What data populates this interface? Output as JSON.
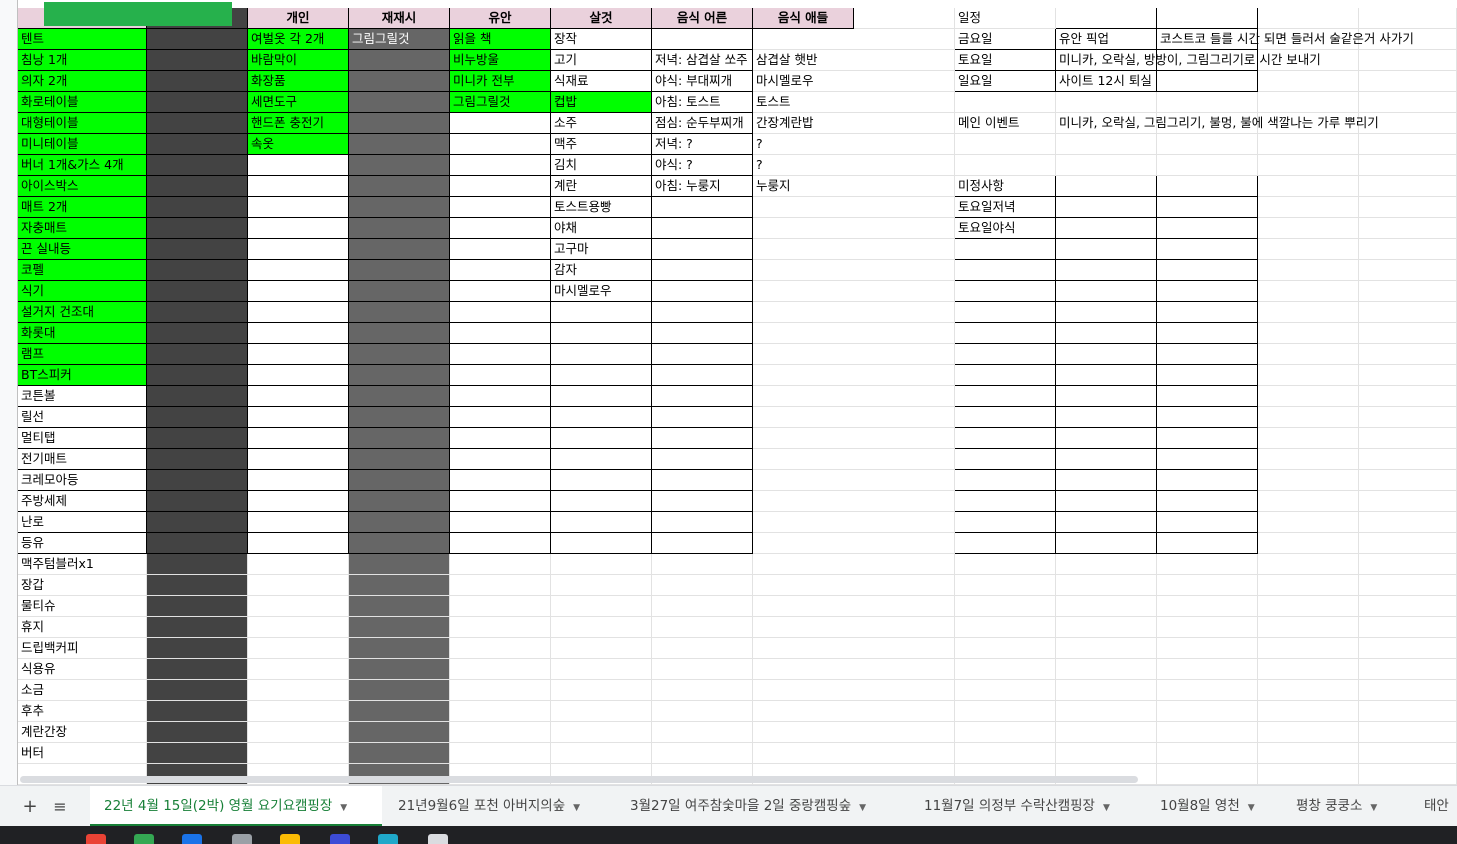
{
  "sheet": {
    "rows": [
      {
        "a": "",
        "b": "",
        "c": "개인",
        "d": "재재시",
        "e": "유안",
        "f": "살것",
        "g": "음식 어른",
        "h": "음식 애들",
        "j": "일정",
        "k": "",
        "l": ""
      },
      {
        "a": "텐트",
        "b": "",
        "c": "여벌옷 각 2개",
        "d": "그림그릴것",
        "e": "읽을 책",
        "f": "장작",
        "g": "",
        "h": "",
        "j": "금요일",
        "k": "유안 픽업",
        "l": "코스트코 들를 시간 되면 들러서 술같은거 사가기"
      },
      {
        "a": "침낭 1개",
        "b": "",
        "c": "바람막이",
        "d": "",
        "e": "비누방울",
        "f": "고기",
        "g": "저녁: 삼겹살 쏘주",
        "h": "삼겹살 햇반",
        "j": "토요일",
        "k": "미니카, 오락실, 방방이, 그림그리기로 시간 보내기",
        "l": ""
      },
      {
        "a": "의자 2개",
        "b": "",
        "c": "화장품",
        "d": "",
        "e": "미니카 전부",
        "f": "식재료",
        "g": "야식: 부대찌개",
        "h": "마시멜로우",
        "j": "일요일",
        "k": "사이트 12시 퇴실",
        "l": ""
      },
      {
        "a": "화로테이블",
        "b": "",
        "c": "세면도구",
        "d": "",
        "e": "그림그릴것",
        "f": "컵밥",
        "g": "아침: 토스트",
        "h": "토스트",
        "j": "",
        "k": "",
        "l": ""
      },
      {
        "a": "대형테이블",
        "b": "",
        "c": "핸드폰 충전기",
        "d": "",
        "e": "",
        "f": "소주",
        "g": "점심: 순두부찌개",
        "h": "간장계란밥",
        "j": "메인 이벤트",
        "k": "미니카, 오락실, 그림그리기, 불멍, 불에 색깔나는 가루 뿌리기",
        "l": ""
      },
      {
        "a": "미니테이블",
        "b": "",
        "c": "속옷",
        "d": "",
        "e": "",
        "f": "맥주",
        "g": "저녁: ?",
        "h": "?",
        "j": "",
        "k": "",
        "l": ""
      },
      {
        "a": "버너 1개&가스 4개",
        "b": "",
        "c": "",
        "d": "",
        "e": "",
        "f": "김치",
        "g": "야식: ?",
        "h": "?",
        "j": "",
        "k": "",
        "l": ""
      },
      {
        "a": "아이스박스",
        "b": "",
        "c": "",
        "d": "",
        "e": "",
        "f": "계란",
        "g": "아침: 누룽지",
        "h": "누룽지",
        "j": "미정사항",
        "k": "",
        "l": ""
      },
      {
        "a": "매트 2개",
        "b": "",
        "c": "",
        "d": "",
        "e": "",
        "f": "토스트용빵",
        "g": "",
        "h": "",
        "j": "토요일저녁",
        "k": "",
        "l": ""
      },
      {
        "a": "자충매트",
        "b": "",
        "c": "",
        "d": "",
        "e": "",
        "f": "야채",
        "g": "",
        "h": "",
        "j": "토요일야식",
        "k": "",
        "l": ""
      },
      {
        "a": "끈 실내등",
        "b": "",
        "c": "",
        "d": "",
        "e": "",
        "f": "고구마",
        "g": "",
        "h": "",
        "j": "",
        "k": "",
        "l": ""
      },
      {
        "a": "코펠",
        "b": "",
        "c": "",
        "d": "",
        "e": "",
        "f": "감자",
        "g": "",
        "h": "",
        "j": "",
        "k": "",
        "l": ""
      },
      {
        "a": "식기",
        "b": "",
        "c": "",
        "d": "",
        "e": "",
        "f": "마시멜로우",
        "g": "",
        "h": "",
        "j": "",
        "k": "",
        "l": ""
      },
      {
        "a": "설거지 건조대",
        "b": "",
        "c": "",
        "d": "",
        "e": "",
        "f": "",
        "g": "",
        "h": "",
        "j": "",
        "k": "",
        "l": ""
      },
      {
        "a": "화롯대",
        "b": "",
        "c": "",
        "d": "",
        "e": "",
        "f": "",
        "g": "",
        "h": "",
        "j": "",
        "k": "",
        "l": ""
      },
      {
        "a": "램프",
        "b": "",
        "c": "",
        "d": "",
        "e": "",
        "f": "",
        "g": "",
        "h": "",
        "j": "",
        "k": "",
        "l": ""
      },
      {
        "a": "BT스피커",
        "b": "",
        "c": "",
        "d": "",
        "e": "",
        "f": "",
        "g": "",
        "h": "",
        "j": "",
        "k": "",
        "l": ""
      },
      {
        "a": "코튼볼",
        "b": "",
        "c": "",
        "d": "",
        "e": "",
        "f": "",
        "g": "",
        "h": "",
        "j": "",
        "k": "",
        "l": ""
      },
      {
        "a": "릴선",
        "b": "",
        "c": "",
        "d": "",
        "e": "",
        "f": "",
        "g": "",
        "h": "",
        "j": "",
        "k": "",
        "l": ""
      },
      {
        "a": "멀티탭",
        "b": "",
        "c": "",
        "d": "",
        "e": "",
        "f": "",
        "g": "",
        "h": "",
        "j": "",
        "k": "",
        "l": ""
      },
      {
        "a": "전기매트",
        "b": "",
        "c": "",
        "d": "",
        "e": "",
        "f": "",
        "g": "",
        "h": "",
        "j": "",
        "k": "",
        "l": ""
      },
      {
        "a": "크레모아등",
        "b": "",
        "c": "",
        "d": "",
        "e": "",
        "f": "",
        "g": "",
        "h": "",
        "j": "",
        "k": "",
        "l": ""
      },
      {
        "a": "주방세제",
        "b": "",
        "c": "",
        "d": "",
        "e": "",
        "f": "",
        "g": "",
        "h": "",
        "j": "",
        "k": "",
        "l": ""
      },
      {
        "a": "난로",
        "b": "",
        "c": "",
        "d": "",
        "e": "",
        "f": "",
        "g": "",
        "h": "",
        "j": "",
        "k": "",
        "l": ""
      },
      {
        "a": "등유",
        "b": "",
        "c": "",
        "d": "",
        "e": "",
        "f": "",
        "g": "",
        "h": "",
        "j": "",
        "k": "",
        "l": ""
      },
      {
        "a": "맥주텀블러x1",
        "b": "",
        "c": "",
        "d": "",
        "e": "",
        "f": "",
        "g": "",
        "h": "",
        "j": "",
        "k": "",
        "l": ""
      },
      {
        "a": "장갑",
        "b": "",
        "c": "",
        "d": "",
        "e": "",
        "f": "",
        "g": "",
        "h": "",
        "j": "",
        "k": "",
        "l": ""
      },
      {
        "a": "물티슈",
        "b": "",
        "c": "",
        "d": "",
        "e": "",
        "f": "",
        "g": "",
        "h": "",
        "j": "",
        "k": "",
        "l": ""
      },
      {
        "a": "휴지",
        "b": "",
        "c": "",
        "d": "",
        "e": "",
        "f": "",
        "g": "",
        "h": "",
        "j": "",
        "k": "",
        "l": ""
      },
      {
        "a": "드립백커피",
        "b": "",
        "c": "",
        "d": "",
        "e": "",
        "f": "",
        "g": "",
        "h": "",
        "j": "",
        "k": "",
        "l": ""
      },
      {
        "a": "식용유",
        "b": "",
        "c": "",
        "d": "",
        "e": "",
        "f": "",
        "g": "",
        "h": "",
        "j": "",
        "k": "",
        "l": ""
      },
      {
        "a": "소금",
        "b": "",
        "c": "",
        "d": "",
        "e": "",
        "f": "",
        "g": "",
        "h": "",
        "j": "",
        "k": "",
        "l": ""
      },
      {
        "a": "후추",
        "b": "",
        "c": "",
        "d": "",
        "e": "",
        "f": "",
        "g": "",
        "h": "",
        "j": "",
        "k": "",
        "l": ""
      },
      {
        "a": "계란간장",
        "b": "",
        "c": "",
        "d": "",
        "e": "",
        "f": "",
        "g": "",
        "h": "",
        "j": "",
        "k": "",
        "l": ""
      },
      {
        "a": "버터",
        "b": "",
        "c": "",
        "d": "",
        "e": "",
        "f": "",
        "g": "",
        "h": "",
        "j": "",
        "k": "",
        "l": ""
      },
      {
        "a": "",
        "b": "",
        "c": "",
        "d": "",
        "e": "",
        "f": "",
        "g": "",
        "h": "",
        "j": "",
        "k": "",
        "l": ""
      }
    ]
  },
  "tabs": {
    "add_label": "+",
    "menu_label": "≡",
    "items": [
      {
        "label": "22년 4월 15일(2박) 영월 요기요캠핑장",
        "active": true
      },
      {
        "label": "21년9월6일 포천 아버지의숲"
      },
      {
        "label": "3월27일 여주참숯마을 2일 중랑캠핑숲"
      },
      {
        "label": "11월7일 의정부 수락산캠핑장"
      },
      {
        "label": "10월8일 영천"
      },
      {
        "label": "평창 쿵쿵소"
      },
      {
        "label": "태안"
      }
    ]
  },
  "colors": {
    "header_pink": "#ead1dc",
    "checked_green": "#00ff00",
    "dark_col_b": "#434343",
    "dark_col_d": "#666666",
    "active_tab": "#188038"
  }
}
